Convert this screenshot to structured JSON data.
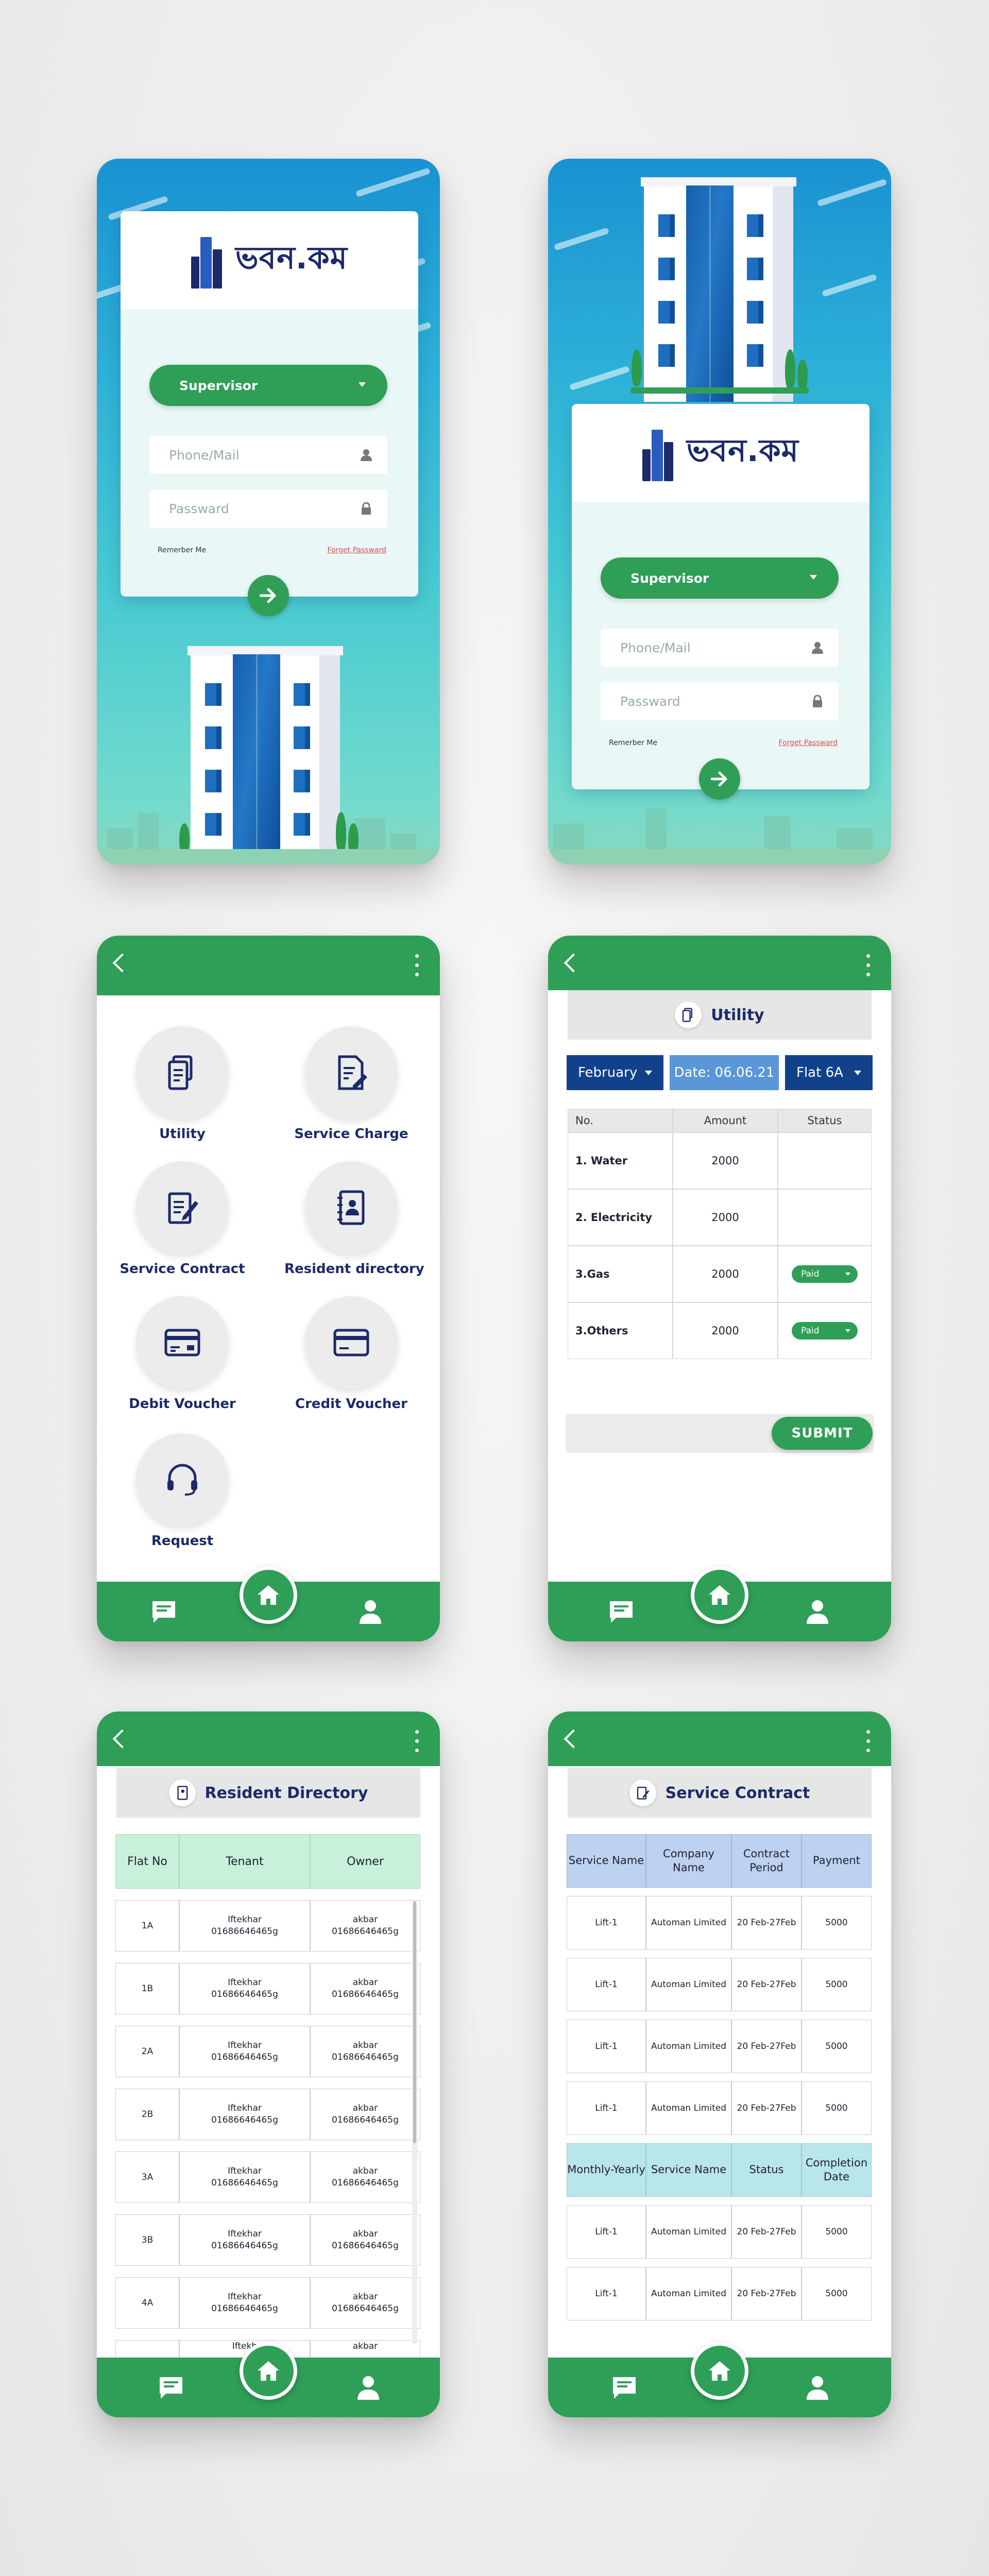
{
  "brand": {
    "logo_text": "ভবন.কম"
  },
  "login": {
    "role": "Supervisor",
    "phone_placeholder": "Phone/Mail",
    "password_placeholder": "Passward",
    "remember": "Remerber Me",
    "forgot": "Forget Passward"
  },
  "home": {
    "tiles": [
      {
        "label": "Utility",
        "icon": "utility-icon"
      },
      {
        "label": "Service Charge",
        "icon": "service-charge-icon"
      },
      {
        "label": "Service Contract",
        "icon": "contract-icon"
      },
      {
        "label": "Resident directory",
        "icon": "directory-icon"
      },
      {
        "label": "Debit Voucher",
        "icon": "card-icon"
      },
      {
        "label": "Credit Voucher",
        "icon": "card-icon"
      },
      {
        "label": "Request",
        "icon": "headset-icon"
      }
    ]
  },
  "utility": {
    "title": "Utility",
    "month": "February",
    "date": "Date:  06.06.21",
    "flat": "Flat 6A",
    "columns": [
      "No.",
      "Amount",
      "Status"
    ],
    "rows": [
      {
        "name": "1. Water",
        "amount": "2000",
        "status": ""
      },
      {
        "name": "2. Electricity",
        "amount": "2000",
        "status": ""
      },
      {
        "name": "3.Gas",
        "amount": "2000",
        "status": "Paid"
      },
      {
        "name": "3.Others",
        "amount": "2000",
        "status": "Paid"
      }
    ],
    "submit": "SUBMIT"
  },
  "resident": {
    "title": "Resident Directory",
    "columns": [
      "Flat No",
      "Tenant",
      "Owner"
    ],
    "rows": [
      {
        "flat": "1A",
        "tenant_name": "Iftekhar",
        "tenant_phone": "01686646465g",
        "owner_name": "akbar",
        "owner_phone": "01686646465g"
      },
      {
        "flat": "1B",
        "tenant_name": "Iftekhar",
        "tenant_phone": "01686646465g",
        "owner_name": "akbar",
        "owner_phone": "01686646465g"
      },
      {
        "flat": "2A",
        "tenant_name": "Iftekhar",
        "tenant_phone": "01686646465g",
        "owner_name": "akbar",
        "owner_phone": "01686646465g"
      },
      {
        "flat": "2B",
        "tenant_name": "Iftekhar",
        "tenant_phone": "01686646465g",
        "owner_name": "akbar",
        "owner_phone": "01686646465g"
      },
      {
        "flat": "3A",
        "tenant_name": "Iftekhar",
        "tenant_phone": "01686646465g",
        "owner_name": "akbar",
        "owner_phone": "01686646465g"
      },
      {
        "flat": "3B",
        "tenant_name": "Iftekhar",
        "tenant_phone": "01686646465g",
        "owner_name": "akbar",
        "owner_phone": "01686646465g"
      },
      {
        "flat": "4A",
        "tenant_name": "Iftekhar",
        "tenant_phone": "01686646465g",
        "owner_name": "akbar",
        "owner_phone": "01686646465g"
      }
    ],
    "partial_row": {
      "tenant_name": "Iftekh",
      "owner_name": "akbar"
    }
  },
  "contract": {
    "title": "Service Contract",
    "columns": [
      "Service Name",
      "Company Name",
      "Contract Period",
      "Payment"
    ],
    "rows": [
      {
        "service": "Lift-1",
        "company": "Automan Limited",
        "period": "20 Feb-27Feb",
        "payment": "5000"
      },
      {
        "service": "Lift-1",
        "company": "Automan Limited",
        "period": "20 Feb-27Feb",
        "payment": "5000"
      },
      {
        "service": "Lift-1",
        "company": "Automan Limited",
        "period": "20 Feb-27Feb",
        "payment": "5000"
      },
      {
        "service": "Lift-1",
        "company": "Automan Limited",
        "period": "20 Feb-27Feb",
        "payment": "5000"
      }
    ],
    "columns2": [
      "Monthly-Yearly",
      "Service Name",
      "Status",
      "Completion Date"
    ],
    "rows2": [
      {
        "service": "Lift-1",
        "company": "Automan Limited",
        "period": "20 Feb-27Feb",
        "payment": "5000"
      },
      {
        "service": "Lift-1",
        "company": "Automan Limited",
        "period": "20 Feb-27Feb",
        "payment": "5000"
      }
    ]
  },
  "colors": {
    "green": "#2f9e57",
    "navy": "#1c2a6a",
    "sky": "#1a92d2",
    "month_bg": "#12418c",
    "date_bg": "#5a96d8"
  }
}
